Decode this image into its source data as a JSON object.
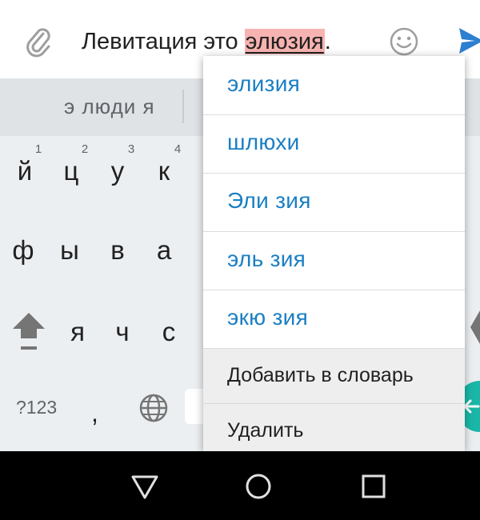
{
  "compose": {
    "text_before": "Левитация это ",
    "misspelled_word": "элюзия",
    "text_after": ".",
    "icons": [
      "paperclip-icon",
      "emoji-icon",
      "send-icon"
    ]
  },
  "keyboard": {
    "suggestion_strip": "э люди я",
    "row1": [
      {
        "key": "й",
        "hint": "1"
      },
      {
        "key": "ц",
        "hint": "2"
      },
      {
        "key": "у",
        "hint": "3"
      },
      {
        "key": "к",
        "hint": "4"
      }
    ],
    "row2": [
      "ф",
      "ы",
      "в",
      "а"
    ],
    "row3": [
      "я",
      "ч",
      "с"
    ],
    "symbols_key": "?123",
    "comma_key": ",",
    "colors": {
      "background": "#eceff1",
      "enter": "#1ab7a8"
    }
  },
  "popup": {
    "suggestions": [
      "элизия",
      "шлюхи",
      "Эли зия",
      "эль зия",
      "экю зия"
    ],
    "add_to_dictionary": "Добавить в словарь",
    "delete": "Удалить",
    "colors": {
      "suggestion_text": "#1a7fc4",
      "action_bg": "#eeeeee"
    }
  },
  "navbar": {
    "icons": [
      "back-icon",
      "home-icon",
      "recents-icon"
    ]
  }
}
